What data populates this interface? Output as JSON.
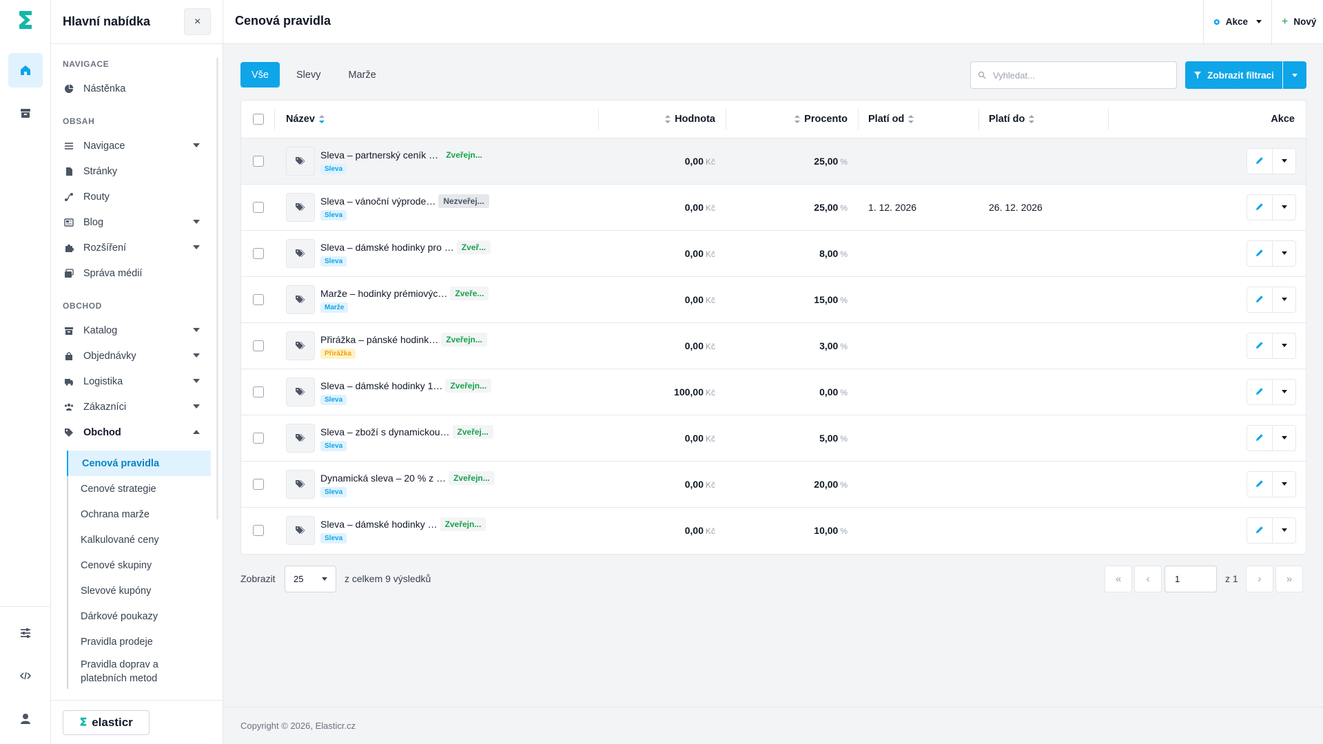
{
  "brand": {
    "logo_text": "elasticr",
    "accent": "#0ea5e9",
    "logo_color": "#14b8a6"
  },
  "rail": {
    "top": [
      {
        "icon": "home-icon",
        "active": true
      },
      {
        "icon": "store-icon",
        "active": false
      }
    ],
    "bottom": [
      {
        "icon": "sliders-icon"
      },
      {
        "icon": "code-icon"
      },
      {
        "icon": "user-icon"
      }
    ]
  },
  "sidebar": {
    "title": "Hlavní nabídka",
    "close_label": "×",
    "sections": [
      {
        "label": "NAVIGACE",
        "items": [
          {
            "label": "Nástěnka",
            "icon": "dashboard-icon",
            "chevron": false
          }
        ]
      },
      {
        "label": "OBSAH",
        "items": [
          {
            "label": "Navigace",
            "icon": "menu-icon",
            "chevron": true
          },
          {
            "label": "Stránky",
            "icon": "file-icon",
            "chevron": false
          },
          {
            "label": "Routy",
            "icon": "route-icon",
            "chevron": false
          },
          {
            "label": "Blog",
            "icon": "newspaper-icon",
            "chevron": true
          },
          {
            "label": "Rozšíření",
            "icon": "puzzle-icon",
            "chevron": true
          },
          {
            "label": "Správa médií",
            "icon": "images-icon",
            "chevron": false
          }
        ]
      },
      {
        "label": "OBCHOD",
        "items": [
          {
            "label": "Katalog",
            "icon": "box-icon",
            "chevron": true
          },
          {
            "label": "Objednávky",
            "icon": "shopping-bag-icon",
            "chevron": true
          },
          {
            "label": "Logistika",
            "icon": "truck-icon",
            "chevron": true
          },
          {
            "label": "Zákazníci",
            "icon": "users-icon",
            "chevron": true
          },
          {
            "label": "Obchod",
            "icon": "tag-icon",
            "chevron": true,
            "expanded": true
          }
        ]
      }
    ],
    "subitems": [
      {
        "label": "Cenová pravidla",
        "active": true
      },
      {
        "label": "Cenové strategie"
      },
      {
        "label": "Ochrana marže"
      },
      {
        "label": "Kalkulované ceny"
      },
      {
        "label": "Cenové skupiny"
      },
      {
        "label": "Slevové kupóny"
      },
      {
        "label": "Dárkové poukazy"
      },
      {
        "label": "Pravidla prodeje"
      },
      {
        "label": "Pravidla doprav a platebních metod",
        "line1": "Pravidla doprav a",
        "line2": "platebních metod"
      }
    ]
  },
  "header": {
    "title": "Cenová pravidla",
    "actions_label": "Akce",
    "new_label": "Nový"
  },
  "toolbar": {
    "tabs": [
      {
        "label": "Vše",
        "active": true
      },
      {
        "label": "Slevy"
      },
      {
        "label": "Marže"
      }
    ],
    "search_placeholder": "Vyhledat...",
    "filter_label": "Zobrazit filtraci"
  },
  "table": {
    "columns": {
      "name": "Název",
      "value": "Hodnota",
      "percent": "Procento",
      "from": "Platí od",
      "to": "Platí do",
      "actions": "Akce"
    },
    "currency": "Kč",
    "percent_unit": "%",
    "rows": [
      {
        "name": "Sleva – partnerský ceník …",
        "status": "Zveřejn...",
        "published": true,
        "type": "Sleva",
        "type_color": "blue",
        "value": "0,00",
        "percent": "25,00",
        "from": "",
        "to": "",
        "highlight": true
      },
      {
        "name": "Sleva – vánoční výprode…",
        "status": "Nezveřej...",
        "published": false,
        "type": "Sleva",
        "type_color": "blue",
        "value": "0,00",
        "percent": "25,00",
        "from": "1. 12. 2026",
        "to": "26. 12. 2026"
      },
      {
        "name": "Sleva – dámské hodinky pro …",
        "status": "Zveř...",
        "published": true,
        "type": "Sleva",
        "type_color": "blue",
        "value": "0,00",
        "percent": "8,00",
        "from": "",
        "to": ""
      },
      {
        "name": "Marže – hodinky prémiovýc…",
        "status": "Zveře...",
        "published": true,
        "type": "Marže",
        "type_color": "blue",
        "value": "0,00",
        "percent": "15,00",
        "from": "",
        "to": ""
      },
      {
        "name": "Přirážka – pánské hodink…",
        "status": "Zveřejn...",
        "published": true,
        "type": "Přirážka",
        "type_color": "orange",
        "value": "0,00",
        "percent": "3,00",
        "from": "",
        "to": ""
      },
      {
        "name": "Sleva – dámské hodinky 1…",
        "status": "Zveřejn...",
        "published": true,
        "type": "Sleva",
        "type_color": "blue",
        "value": "100,00",
        "percent": "0,00",
        "from": "",
        "to": ""
      },
      {
        "name": "Sleva – zboží s dynamickou…",
        "status": "Zveřej...",
        "published": true,
        "type": "Sleva",
        "type_color": "blue",
        "value": "0,00",
        "percent": "5,00",
        "from": "",
        "to": ""
      },
      {
        "name": "Dynamická sleva – 20 % z …",
        "status": "Zveřejn...",
        "published": true,
        "type": "Sleva",
        "type_color": "blue",
        "value": "0,00",
        "percent": "20,00",
        "from": "",
        "to": ""
      },
      {
        "name": "Sleva – dámské hodinky …",
        "status": "Zveřejn...",
        "published": true,
        "type": "Sleva",
        "type_color": "blue",
        "value": "0,00",
        "percent": "10,00",
        "from": "",
        "to": ""
      }
    ]
  },
  "pagination": {
    "show_label": "Zobrazit",
    "page_size": "25",
    "total_label": "z celkem 9 výsledků",
    "first": "«",
    "prev": "‹",
    "next": "›",
    "last": "»",
    "current_page": "1",
    "of_label": "z 1"
  },
  "footer": {
    "copyright": "Copyright © 2026, Elasticr.cz"
  }
}
